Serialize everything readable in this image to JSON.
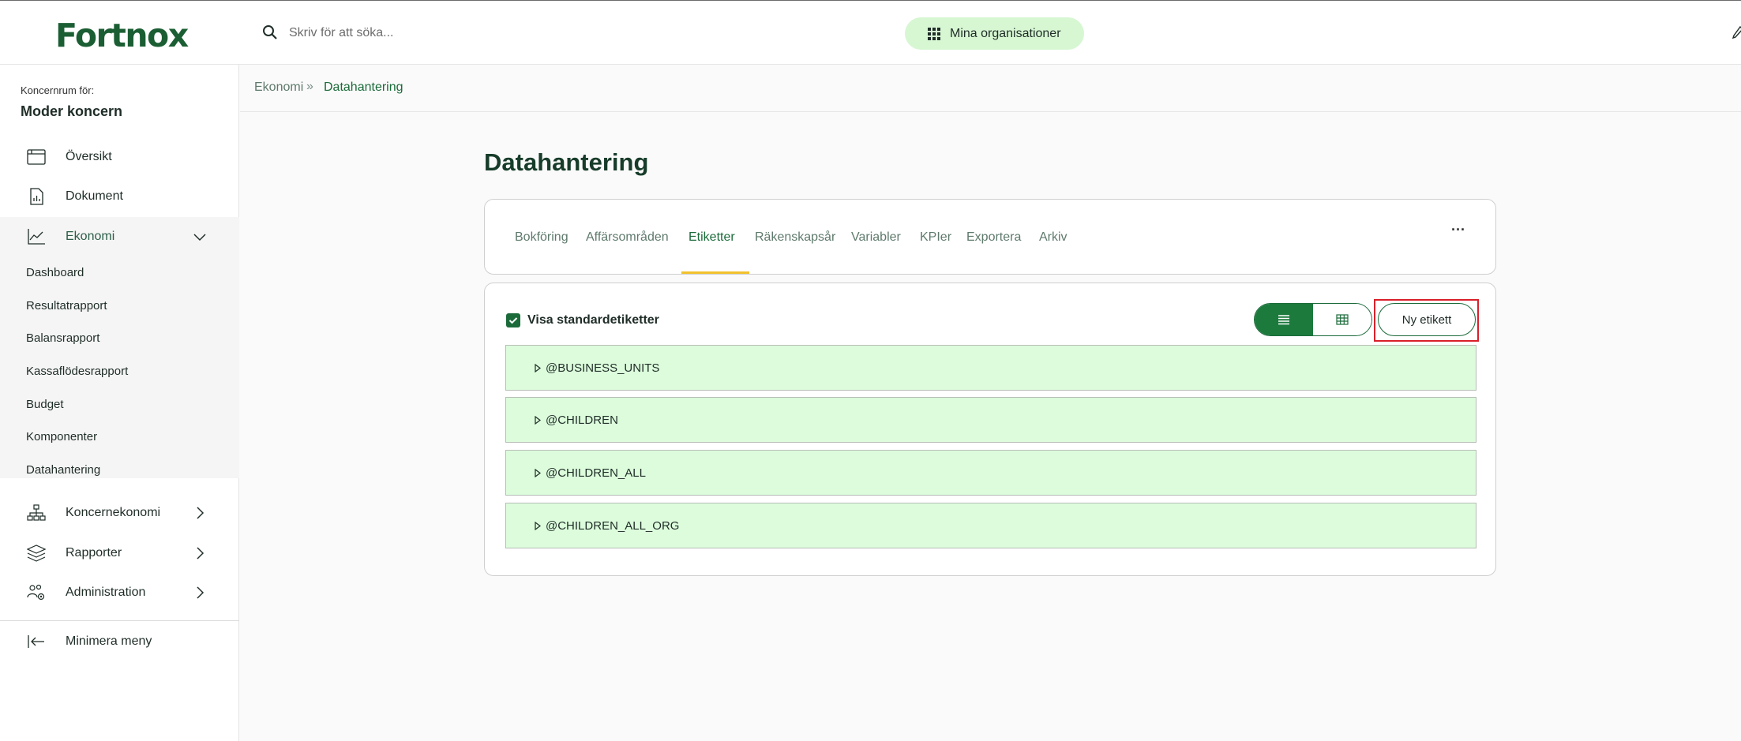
{
  "header": {
    "logo_text": "Fortnox",
    "search_placeholder": "Skriv för att söka...",
    "org_button_label": "Mina organisationer",
    "accent_color": "#d7f7d3",
    "brand_color": "#1b5e33"
  },
  "sidebar": {
    "caption": "Koncernrum för:",
    "company": "Moder koncern",
    "items": [
      {
        "label": "Översikt",
        "icon": "calendar-icon"
      },
      {
        "label": "Dokument",
        "icon": "document-chart-icon"
      },
      {
        "label": "Ekonomi",
        "icon": "line-chart-icon",
        "expanded": true
      },
      {
        "label": "Koncernekonomi",
        "icon": "org-tree-icon"
      },
      {
        "label": "Rapporter",
        "icon": "layers-icon"
      },
      {
        "label": "Administration",
        "icon": "users-gear-icon"
      }
    ],
    "subitems": [
      "Dashboard",
      "Resultatrapport",
      "Balansrapport",
      "Kassaflödesrapport",
      "Budget",
      "Komponenter",
      "Datahantering"
    ],
    "minimize_label": "Minimera meny"
  },
  "breadcrumb": {
    "parent": "Ekonomi",
    "separator": "»",
    "current": "Datahantering"
  },
  "page": {
    "title": "Datahantering"
  },
  "tabs": {
    "items": [
      "Bokföring",
      "Affärsområden",
      "Etiketter",
      "Räkenskapsår",
      "Variabler",
      "KPIer",
      "Exportera",
      "Arkiv"
    ],
    "active": "Etiketter",
    "more_label": "···"
  },
  "labels_panel": {
    "checkbox_label": "Visa standardetiketter",
    "checkbox_checked": true,
    "view_mode": "list",
    "new_button_label": "Ny etikett",
    "rows": [
      "@BUSINESS_UNITS",
      "@CHILDREN",
      "@CHILDREN_ALL",
      "@CHILDREN_ALL_ORG"
    ],
    "row_color": "#dcfcdc"
  }
}
